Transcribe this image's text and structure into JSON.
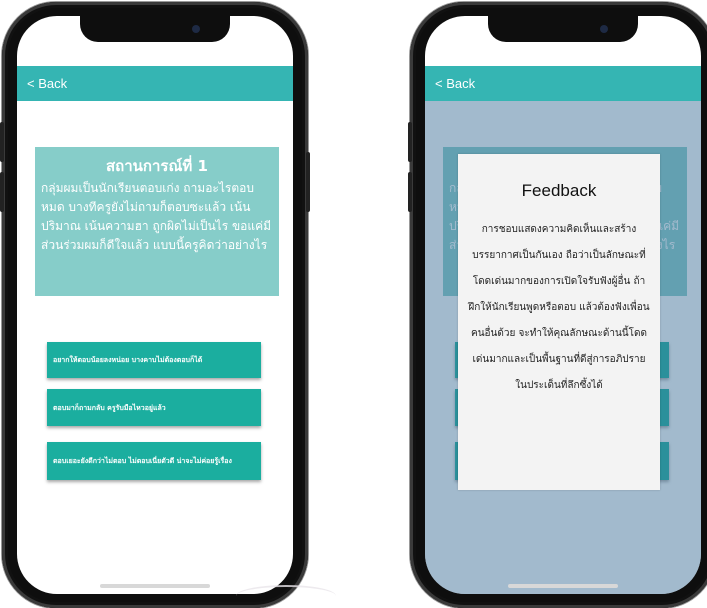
{
  "left_screen": {
    "nav": {
      "back_label": "< Back"
    },
    "scenario": {
      "title": "สถานการณ์ที่ 1",
      "body": "กลุ่มผมเป็นนักเรียนตอบเก่ง ถามอะไรตอบหมด บางทีครูยังไม่ถามก็ตอบซะแล้ว เน้นปริมาณ เน้นความฮา ถูกผิดไม่เป็นไร ขอแค่มีส่วนร่วมผมก็ดีใจแล้ว แบบนี้ครูคิดว่าอย่างไร"
    },
    "options": [
      "อยากให้ตอบน้อยลงหน่อย บางคาบไม่ต้องตอบก็ได้",
      "ตอบมาก็ถามกลับ ครูรับมือไหวอยู่แล้ว",
      "ตอบเยอะยังดีกว่าไม่ตอบ ไม่ตอบเนี่ยตัวดี น่าจะไม่ค่อยรู้เรื่อง"
    ]
  },
  "right_screen": {
    "nav": {
      "back_label": "< Back"
    },
    "feedback": {
      "title": "Feedback",
      "body": "การชอบแสดงความคิดเห็นและสร้างบรรยากาศเป็นกันเอง ถือว่าเป็นลักษณะที่โดดเด่นมากของการเปิดใจรับฟังผู้อื่น ถ้าฝึกให้นักเรียนพูดหรือตอบ แล้วต้องฟังเพื่อนคนอื่นด้วย จะทำให้คุณลักษณะด้านนี้โดดเด่นมากและเป็นพื้นฐานที่ดีสู่การอภิปรายในประเด็นที่ลึกซึ้งได้"
    }
  },
  "colors": {
    "nav": "#35b5b3",
    "scenario_bg": "#86cdc9",
    "option_bg": "#1bae9f",
    "overlay": "#3c6e96",
    "modal_bg": "#f3f3f3"
  }
}
